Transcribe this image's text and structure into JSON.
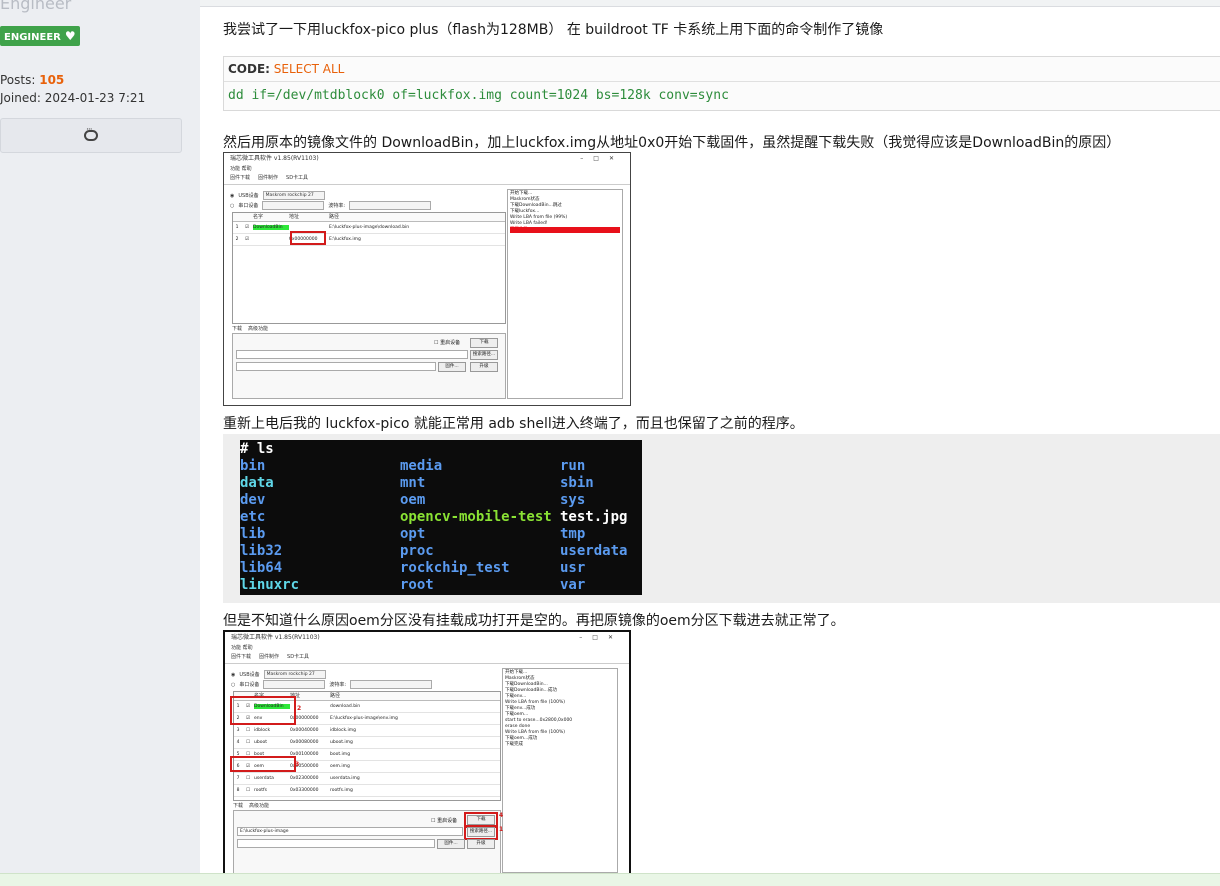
{
  "sidebar": {
    "rank_label": "Engineer",
    "badge_label": "ENGINEER",
    "posts_label": "Posts:",
    "posts_value": "105",
    "joined_label": "Joined:",
    "joined_value": "2024-01-23 7:21"
  },
  "post": {
    "p1": "我尝试了一下用luckfox-pico plus（flash为128MB） 在 buildroot TF 卡系统上用下面的命令制作了镜像",
    "code_label": "CODE:",
    "code_select_all": "SELECT ALL",
    "code_text": "dd if=/dev/mtdblock0 of=luckfox.img count=1024 bs=128k conv=sync",
    "p2": "然后用原本的镜像文件的 DownloadBin，加上luckfox.img从地址0x0开始下载固件，虽然提醒下载失败（我觉得应该是DownloadBin的原因）",
    "p3": "重新上电后我的 luckfox-pico 就能正常用 adb shell进入终端了，而且也保留了之前的程序。",
    "p4": "但是不知道什么原因oem分区没有挂载成功打开是空的。再把原镜像的oem分区下载进去就正常了。"
  },
  "shot1": {
    "title": "瑞芯微工具软件 v1.85(RV1103)",
    "menu": "功能    帮助",
    "tabs": [
      "固件下载",
      "固件制作",
      "SD卡工具"
    ],
    "usb_label": "USB设备",
    "usb_device": "Maskrom rockchip 27",
    "serial_label": "串口设备",
    "baud_label": "波特率:",
    "headers": [
      "",
      "",
      "名字",
      "地址",
      "路径"
    ],
    "rows": [
      {
        "n": "1",
        "name": "DownloadBin",
        "addr": "",
        "path": "E:\\luckfox-plus-image\\download.bin"
      },
      {
        "n": "2",
        "name": "",
        "addr": "0x00000000",
        "path": "E:\\luckfox.img"
      }
    ],
    "log": [
      "开始下载...",
      "Maskrom状态",
      "下载DownloadBin...跳过",
      "下载luckfox...",
      "Write LBA from file (99%)",
      "Write LBA failed!",
      "下载失败"
    ],
    "low_tabs": [
      "下载",
      "高级功能"
    ],
    "reboot_label": "重启设备",
    "download_btn": "下载",
    "search_btn": "搜索路径...",
    "firmware_btn": "固件...",
    "upgrade_btn": "升级"
  },
  "terminal": {
    "prompt": "# ls",
    "col1": [
      "bin",
      "data",
      "dev",
      "etc",
      "lib",
      "lib32",
      "lib64",
      "linuxrc"
    ],
    "col2": [
      "media",
      "mnt",
      "oem",
      "opencv-mobile-test",
      "opt",
      "proc",
      "rockchip_test",
      "root"
    ],
    "col3": [
      "run",
      "sbin",
      "sys",
      "test.jpg",
      "tmp",
      "userdata",
      "usr",
      "var"
    ],
    "colors": {
      "dir": "#5b9bf0",
      "link": "#5fd7e8",
      "exe": "#8ae234",
      "file": "#ffffff"
    }
  },
  "shot2": {
    "title": "瑞芯微工具软件 v1.85(RV1103)",
    "menu": "功能    帮助",
    "tabs": [
      "固件下载",
      "固件制作",
      "SD卡工具"
    ],
    "usb_label": "USB设备",
    "usb_device": "Maskrom rockchip 27",
    "serial_label": "串口设备",
    "baud_label": "波特率:",
    "headers": [
      "",
      "",
      "名字",
      "地址",
      "路径"
    ],
    "rows": [
      {
        "n": "1",
        "name": "DownloadBin",
        "addr": "",
        "path": "download.bin"
      },
      {
        "n": "2",
        "name": "env",
        "addr": "0x00000000",
        "path": "E:\\luckfox-plus-image\\env.img"
      },
      {
        "n": "3",
        "name": "idblock",
        "addr": "0x00040000",
        "path": "idblock.img"
      },
      {
        "n": "4",
        "name": "uboot",
        "addr": "0x00080000",
        "path": "uboot.img"
      },
      {
        "n": "5",
        "name": "boot",
        "addr": "0x00100000",
        "path": "boot.img"
      },
      {
        "n": "6",
        "name": "oem",
        "addr": "0x00500000",
        "path": "oem.img"
      },
      {
        "n": "7",
        "name": "userdata",
        "addr": "0x02300000",
        "path": "userdata.img"
      },
      {
        "n": "8",
        "name": "rootfs",
        "addr": "0x03300000",
        "path": "rootfs.img"
      }
    ],
    "log": [
      "开始下载...",
      "Maskrom状态",
      "下载DownloadBin...",
      "下载DownloadBin...成功",
      "下载env...",
      "Write LBA from file (100%)",
      "下载env...成功",
      "下载oem...",
      "start to erase...0x2800,0x000",
      "erase done",
      "Write LBA from file (100%)",
      "下载oem...成功",
      "下载完成"
    ],
    "low_tabs": [
      "下载",
      "高级功能"
    ],
    "path_value": "E:\\luckfox-plus-image",
    "reboot_label": "重启设备",
    "download_btn": "下载",
    "search_btn": "搜索路径...",
    "firmware_btn": "固件...",
    "upgrade_btn": "升级",
    "markers": [
      "2",
      "3",
      "4",
      "1"
    ]
  }
}
